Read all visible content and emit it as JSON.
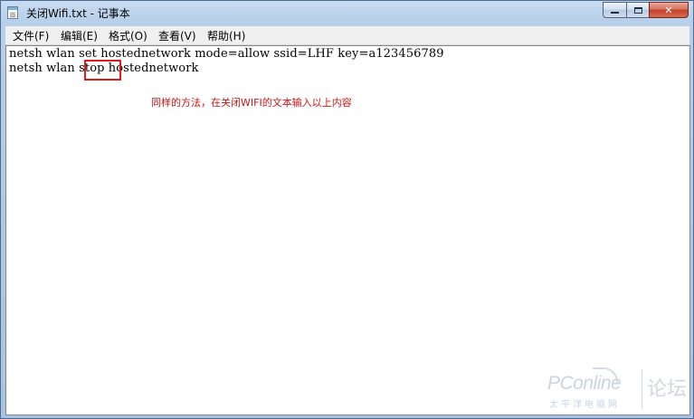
{
  "window": {
    "title": "关闭Wifi.txt - 记事本"
  },
  "menu": {
    "items": [
      "文件(F)",
      "编辑(E)",
      "格式(O)",
      "查看(V)",
      "帮助(H)"
    ]
  },
  "editor": {
    "lines": [
      "netsh wlan set hostednetwork mode=allow ssid=LHF key=a123456789",
      "netsh wlan stop hostednetwork"
    ],
    "highlighted_word": "stop",
    "annotation": "同样的方法，在关闭WIFI的文本输入以上内容"
  },
  "watermark": {
    "brand": "PConline",
    "subtitle": "太平洋电脑网",
    "forum": "论坛"
  },
  "colors": {
    "annotation": "#d01414",
    "highlight_box": "#e01b1b"
  },
  "icons": {
    "app": "notepad-icon",
    "minimize": "minimize-icon",
    "maximize": "maximize-icon",
    "close": "close-icon"
  }
}
